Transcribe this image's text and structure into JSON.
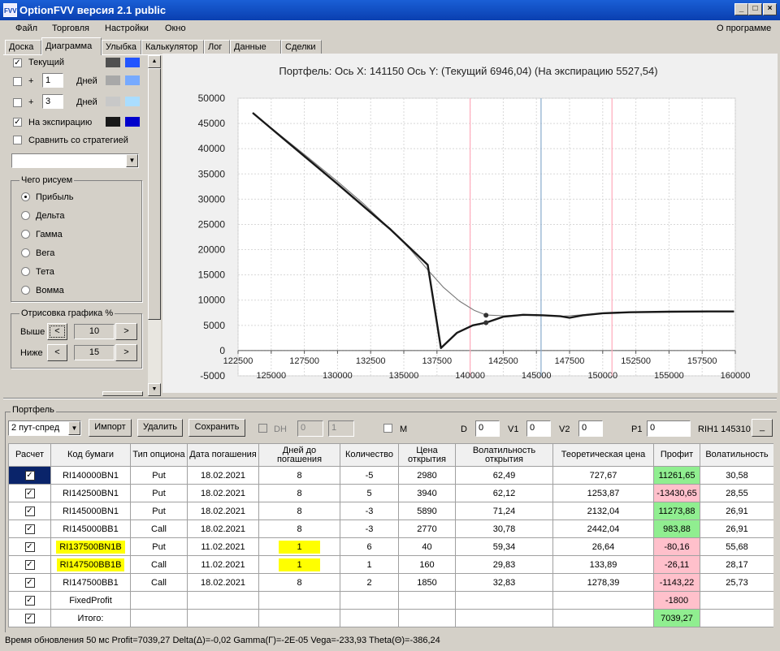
{
  "window": {
    "title": "OptionFVV версия 2.1 public",
    "icon_text": "FVV"
  },
  "menu": {
    "items": [
      "Файл",
      "Торговля",
      "Настройки",
      "Окно"
    ],
    "about": "О программе"
  },
  "tabs": [
    "Доска",
    "Диаграмма",
    "Улыбка",
    "Калькулятор",
    "Лог",
    "Данные",
    "Сделки"
  ],
  "active_tab": "Диаграмма",
  "left_panel": {
    "current_label": "Текущий",
    "plus1_value": "1",
    "plus_sign": "+",
    "days_label": "Дней",
    "plus3_value": "3",
    "expiry_label": "На экспирацию",
    "compare_label": "Сравнить со стратегией",
    "compare_select": "",
    "draw_group_title": "Чего рисуем",
    "draw_options": [
      "Прибыль",
      "Дельта",
      "Гамма",
      "Вега",
      "Тета",
      "Вомма"
    ],
    "render_group_title": "Отрисовка графика %",
    "above_label": "Выше",
    "above_value": "10",
    "below_label": "Ниже",
    "below_value": "15",
    "colors": {
      "current": [
        "#505050",
        "#2255ff"
      ],
      "plus1": [
        "#a8a8a8",
        "#77aaff"
      ],
      "plus3": [
        "#c8c8c8",
        "#aaddff"
      ],
      "expiry": [
        "#181818",
        "#0000cc"
      ]
    }
  },
  "chart_header": {
    "text": "Портфель: Ось X: 141150 Ось Y:  (Текущий 6946,04)  (На экспирацию 5527,54)"
  },
  "chart_data": {
    "type": "line",
    "xlim": [
      122500,
      160000
    ],
    "ylim": [
      -5000,
      50000
    ],
    "x_ticks_top": [
      "122500",
      "127500",
      "132500",
      "137500",
      "142500",
      "147500",
      "152500",
      "157500"
    ],
    "x_ticks_bottom": [
      "125000",
      "130000",
      "135000",
      "140000",
      "145000",
      "150000",
      "155000",
      "160000"
    ],
    "y_ticks": [
      "50000",
      "45000",
      "40000",
      "35000",
      "30000",
      "25000",
      "20000",
      "15000",
      "10000",
      "5000",
      "0",
      "-5000"
    ],
    "grid": true,
    "vertical_lines": [
      {
        "x": 140000,
        "color": "#ffaabb"
      },
      {
        "x": 145350,
        "color": "#88aacc"
      },
      {
        "x": 150700,
        "color": "#ffaabb"
      }
    ],
    "series": [
      {
        "color": "#777777",
        "points": [
          [
            123600,
            47100
          ],
          [
            126000,
            42000
          ],
          [
            128000,
            37800
          ],
          [
            130000,
            33500
          ],
          [
            132000,
            29000
          ],
          [
            134000,
            24000
          ],
          [
            135500,
            20000
          ],
          [
            136800,
            16000
          ],
          [
            138000,
            12500
          ],
          [
            139200,
            9800
          ],
          [
            140300,
            8000
          ],
          [
            141200,
            7050
          ],
          [
            142500,
            6900
          ],
          [
            144000,
            7100
          ],
          [
            145500,
            7000
          ],
          [
            147000,
            6800
          ],
          [
            148500,
            7100
          ],
          [
            150000,
            7400
          ],
          [
            152000,
            7600
          ],
          [
            155000,
            7700
          ],
          [
            158000,
            7750
          ],
          [
            159900,
            7750
          ]
        ]
      },
      {
        "color": "#181818",
        "points": [
          [
            123600,
            47100
          ],
          [
            126000,
            41800
          ],
          [
            128000,
            37400
          ],
          [
            130000,
            33000
          ],
          [
            132000,
            28500
          ],
          [
            134000,
            24000
          ],
          [
            135000,
            21500
          ],
          [
            136000,
            19000
          ],
          [
            136800,
            17000
          ],
          [
            137800,
            500
          ],
          [
            139000,
            3500
          ],
          [
            140200,
            5000
          ],
          [
            141200,
            5528
          ],
          [
            142500,
            6700
          ],
          [
            144000,
            7100
          ],
          [
            145500,
            7000
          ],
          [
            146800,
            6800
          ],
          [
            147500,
            6500
          ],
          [
            148500,
            7000
          ],
          [
            150000,
            7400
          ],
          [
            152000,
            7600
          ],
          [
            155000,
            7700
          ],
          [
            158000,
            7750
          ],
          [
            159900,
            7750
          ]
        ]
      }
    ],
    "markers": [
      {
        "x": 141200,
        "y": 7000
      },
      {
        "x": 141200,
        "y": 5528
      }
    ]
  },
  "portfolio": {
    "group_title": "Портфель",
    "strategy_select": "2 пут-спред",
    "import_btn": "Импорт",
    "delete_btn": "Удалить",
    "save_btn": "Сохранить",
    "dh_label": "DH",
    "dh_val1": "0",
    "dh_val2": "1",
    "m_label": "M",
    "d_label": "D",
    "d_value": "0",
    "v1_label": "V1",
    "v1_value": "0",
    "v2_label": "V2",
    "v2_value": "0",
    "p1_label": "P1",
    "p1_value": "0",
    "instrument": "RIH1 145310",
    "dots_btn": "_"
  },
  "table": {
    "headers": [
      "Расчет",
      "Код бумаги",
      "Тип опциона",
      "Дата погашения",
      "Дней до погашения",
      "Количество",
      "Цена открытия",
      "Волатильность открытия",
      "Теоретическая цена",
      "Профит",
      "Волатильность"
    ],
    "rows": [
      [
        "✓",
        "RI140000BN1",
        "Put",
        "18.02.2021",
        "8",
        "-5",
        "2980",
        "62,49",
        "727,67",
        "11261,65",
        "30,58"
      ],
      [
        "✓",
        "RI142500BN1",
        "Put",
        "18.02.2021",
        "8",
        "5",
        "3940",
        "62,12",
        "1253,87",
        "-13430,65",
        "28,55"
      ],
      [
        "✓",
        "RI145000BN1",
        "Put",
        "18.02.2021",
        "8",
        "-3",
        "5890",
        "71,24",
        "2132,04",
        "11273,88",
        "26,91"
      ],
      [
        "✓",
        "RI145000BB1",
        "Call",
        "18.02.2021",
        "8",
        "-3",
        "2770",
        "30,78",
        "2442,04",
        "983,88",
        "26,91"
      ],
      [
        "✓",
        "RI137500BN1B",
        "Put",
        "11.02.2021",
        "1",
        "6",
        "40",
        "59,34",
        "26,64",
        "-80,16",
        "55,68"
      ],
      [
        "✓",
        "RI147500BB1B",
        "Call",
        "11.02.2021",
        "1",
        "1",
        "160",
        "29,83",
        "133,89",
        "-26,11",
        "28,17"
      ],
      [
        "✓",
        "RI147500BB1",
        "Call",
        "18.02.2021",
        "8",
        "2",
        "1850",
        "32,83",
        "1278,39",
        "-1143,22",
        "25,73"
      ],
      [
        "✓",
        "FixedProfit",
        "",
        "",
        "",
        "",
        "",
        "",
        "",
        "-1800",
        ""
      ],
      [
        "✓",
        "Итого:",
        "",
        "",
        "",
        "",
        "",
        "",
        "",
        "7039,27",
        ""
      ]
    ],
    "profit_colors": [
      "green",
      "pink",
      "green",
      "green",
      "pink",
      "pink",
      "pink",
      "pink",
      "green"
    ]
  },
  "status": {
    "text": "Время обновления 50 мс  Profit=7039,27 Delta(Δ)=-0,02 Gamma(Γ)=-2E-05 Vega=-233,93 Theta(Θ)=-386,24"
  }
}
